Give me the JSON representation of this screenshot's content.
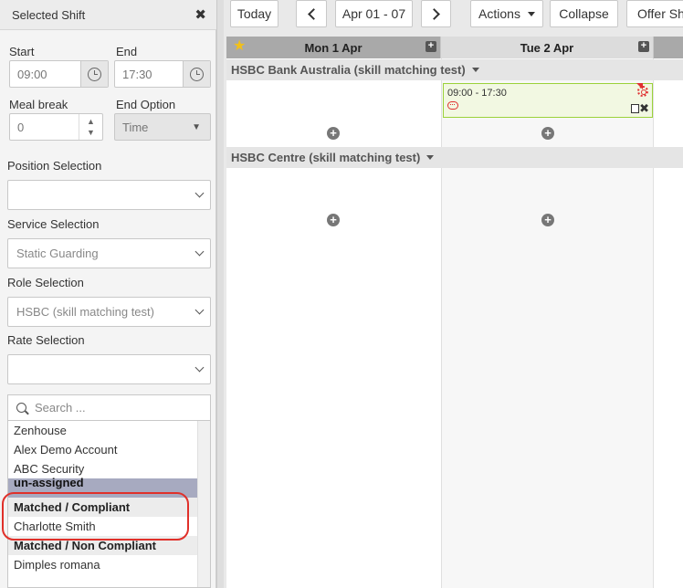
{
  "panel": {
    "title": "Selected Shift",
    "close_glyph": "✖",
    "start_label": "Start",
    "start_value": "09:00",
    "end_label": "End",
    "end_value": "17:30",
    "meal_break_label": "Meal break",
    "meal_break_value": "0",
    "end_option_label": "End Option",
    "end_option_value": "Time",
    "position_label": "Position Selection",
    "position_value": "",
    "service_label": "Service Selection",
    "service_value": "Static Guarding",
    "role_label": "Role Selection",
    "role_value": "HSBC (skill matching test)",
    "rate_label": "Rate Selection",
    "rate_value": "",
    "search_placeholder": "Search ...",
    "list": [
      {
        "label": "Zenhouse",
        "kind": "item"
      },
      {
        "label": "Alex Demo Account",
        "kind": "item"
      },
      {
        "label": "ABC Security",
        "kind": "item"
      },
      {
        "label": "un-assigned",
        "kind": "selected"
      },
      {
        "label": "Matched / Compliant",
        "kind": "group"
      },
      {
        "label": "Charlotte Smith",
        "kind": "item"
      },
      {
        "label": "Matched / Non Compliant",
        "kind": "group"
      },
      {
        "label": "Dimples romana",
        "kind": "item"
      }
    ]
  },
  "toolbar": {
    "today": "Today",
    "date_range": "Apr 01 - 07",
    "actions": "Actions",
    "collapse": "Collapse",
    "offer_shifts": "Offer Shi"
  },
  "calendar": {
    "days": [
      "Mon 1 Apr",
      "Tue 2 Apr"
    ],
    "sites": [
      "HSBC Bank Australia (skill matching test)",
      "HSBC Centre (skill matching test)"
    ],
    "shift": {
      "time": "09:00 - 17:30"
    }
  },
  "colors": {
    "annotation_circle": "#e0302a",
    "shift_border": "#9bd23a",
    "selected_row": "#a7aac0"
  }
}
